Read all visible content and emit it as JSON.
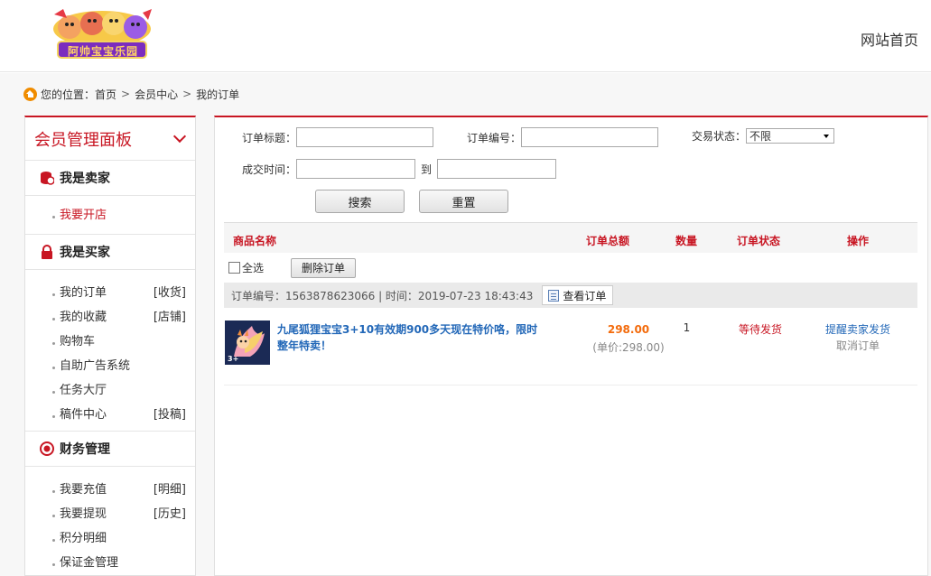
{
  "header": {
    "logo_text": "阿帅宝宝乐园",
    "home_link": "网站首页"
  },
  "breadcrumb": {
    "prefix": "您的位置：",
    "items": [
      "首页",
      "会员中心",
      "我的订单"
    ],
    "separator": ">"
  },
  "sidebar": {
    "title": "会员管理面板",
    "groups": [
      {
        "title": "我是卖家",
        "icon": "coins-icon",
        "items": [
          {
            "label": "我要开店",
            "extra": "",
            "active": true
          }
        ]
      },
      {
        "title": "我是买家",
        "icon": "lock-icon",
        "items": [
          {
            "label": "我的订单",
            "extra": "[收货]"
          },
          {
            "label": "我的收藏",
            "extra": "[店铺]"
          },
          {
            "label": "购物车",
            "extra": ""
          },
          {
            "label": "自助广告系统",
            "extra": ""
          },
          {
            "label": "任务大厅",
            "extra": ""
          },
          {
            "label": "稿件中心",
            "extra": "[投稿]"
          }
        ]
      },
      {
        "title": "财务管理",
        "icon": "target-icon",
        "items": [
          {
            "label": "我要充值",
            "extra": "[明细]"
          },
          {
            "label": "我要提现",
            "extra": "[历史]"
          },
          {
            "label": "积分明细",
            "extra": ""
          },
          {
            "label": "保证金管理",
            "extra": ""
          }
        ]
      }
    ]
  },
  "filters": {
    "title_label": "订单标题：",
    "number_label": "订单编号：",
    "status_label": "交易状态：",
    "status_value": "不限",
    "time_label": "成交时间：",
    "to_label": "到",
    "search_button": "搜索",
    "reset_button": "重置"
  },
  "table": {
    "headers": {
      "name": "商品名称",
      "total": "订单总额",
      "qty": "数量",
      "status": "订单状态",
      "action": "操作"
    },
    "select_all": "全选",
    "delete_button": "删除订单"
  },
  "order": {
    "meta": "订单编号：1563878623066 | 时间：2019-07-23 18:43:43",
    "view_button": "查看订单",
    "product_name": "九尾狐狸宝宝3+10有效期900多天现在特价咯，限时整年特卖！",
    "thumb_badge": "3+",
    "total": "298.00",
    "unit_price": "(单价:298.00)",
    "qty": "1",
    "status": "等待发货",
    "remind_action": "提醒卖家发货",
    "cancel_action": "取消订单"
  },
  "colors": {
    "accent": "#c81623",
    "link": "#2368b8",
    "price": "#f36b0c"
  }
}
